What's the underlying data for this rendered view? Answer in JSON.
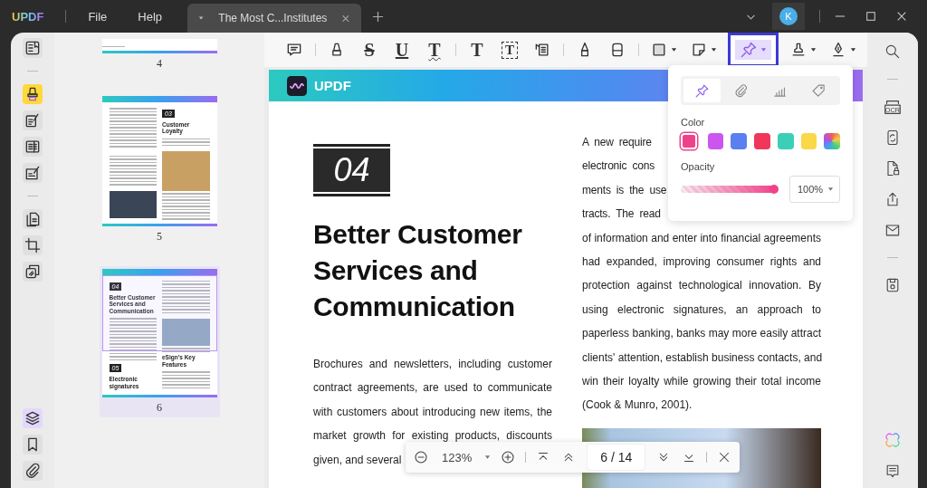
{
  "titlebar": {
    "logo": "UPDF",
    "menu": [
      "File",
      "Help"
    ],
    "tab": {
      "title": "The Most C...Institutes"
    },
    "avatar": "K"
  },
  "left_tool_groups": [
    [
      {
        "kind": "reader",
        "selected": false
      }
    ],
    [
      {
        "kind": "highlight",
        "selected": true
      },
      {
        "kind": "edit",
        "selected": false
      },
      {
        "kind": "form",
        "selected": false
      },
      {
        "kind": "sign",
        "selected": false
      }
    ],
    [
      {
        "kind": "pages",
        "selected": false
      },
      {
        "kind": "crop",
        "selected": false
      },
      {
        "kind": "batch",
        "selected": false
      }
    ]
  ],
  "left_bottom_tools": [
    {
      "kind": "layers",
      "selected": true
    },
    {
      "kind": "bookmark",
      "selected": false
    },
    {
      "kind": "clip",
      "selected": false
    }
  ],
  "thumbnails": [
    {
      "kind": "tail",
      "page": "4",
      "selected": false
    },
    {
      "kind": "loyalty",
      "page": "5",
      "selected": false,
      "number": "03",
      "heading": "Customer Loyalty"
    },
    {
      "kind": "services",
      "page": "6",
      "selected": true,
      "number": "04",
      "heading": "Better Customer Services and Communication",
      "number_2": "05",
      "heading_2": "Electronic signatures",
      "subheading": "eSign's Key Features"
    }
  ],
  "toolbar_groups": [
    [
      {
        "kind": "comment",
        "selected": false
      }
    ],
    [
      {
        "kind": "highlighter",
        "selected": false
      },
      {
        "kind": "glyph-strike",
        "glyph": "S",
        "selected": false
      },
      {
        "kind": "glyph-underline",
        "glyph": "U",
        "selected": false
      },
      {
        "kind": "glyph-squiggly",
        "glyph": "T",
        "selected": false
      }
    ],
    [
      {
        "kind": "glyph-plain",
        "glyph": "T",
        "selected": false
      },
      {
        "kind": "glyph-boxed",
        "glyph": "T",
        "selected": false
      },
      {
        "kind": "callout",
        "selected": false
      }
    ],
    [
      {
        "kind": "pencil",
        "selected": false
      },
      {
        "kind": "eraser",
        "selected": false
      }
    ],
    [
      {
        "kind": "shape",
        "selected": false,
        "dropdown": true
      },
      {
        "kind": "sticker",
        "selected": false,
        "dropdown": true
      },
      {
        "kind": "pin",
        "selected": true,
        "dropdown": true
      },
      {
        "kind": "stamp",
        "selected": false,
        "dropdown": true
      },
      {
        "kind": "signature",
        "selected": false,
        "dropdown": true
      }
    ]
  ],
  "document": {
    "banner_logo": "UPDF",
    "number": "04",
    "heading": [
      "Better Customer",
      "Services and",
      "Communication"
    ],
    "left_lines": [
      "Brochures and newsletters, including customer",
      "contract agreements, are used to communicate",
      "with customers about introducing new items, the",
      "market growth for existing products, discounts",
      "given, and several"
    ],
    "right_lines": [
      "A new require",
      "electronic cons",
      "ments is the use",
      "tracts. The read",
      "of information and enter into financial agreements",
      "had expanded, improving consumer rights and",
      "protection against technological innovation. By",
      "using electronic signatures, an approach to",
      "paperless banking, banks may more easily attract",
      "clients' attention, establish business contacts, and",
      "win their loyalty while growing their total income",
      "(Cook & Munro, 2001)."
    ]
  },
  "popup": {
    "tabs": [
      {
        "kind": "pin",
        "selected": true
      },
      {
        "kind": "clip",
        "selected": false
      },
      {
        "kind": "chart",
        "selected": false
      },
      {
        "kind": "tag",
        "selected": false
      }
    ],
    "color_label": "Color",
    "colors": [
      {
        "kind": "solid",
        "color": "#f0428a",
        "selected": true
      },
      {
        "kind": "solid",
        "color": "#cc55f0",
        "selected": false
      },
      {
        "kind": "solid",
        "color": "#5a7ff0",
        "selected": false
      },
      {
        "kind": "solid",
        "color": "#f0365a",
        "selected": false
      },
      {
        "kind": "solid",
        "color": "#3ccfb8",
        "selected": false
      },
      {
        "kind": "solid",
        "color": "#f9d84a",
        "selected": false
      },
      {
        "kind": "spectrum",
        "selected": false
      }
    ],
    "opacity_label": "Opacity",
    "opacity": {
      "level": 1
    },
    "opacity_value": "100%"
  },
  "nav": {
    "zoom": "123%",
    "page": "6 / 14"
  },
  "right_tool_groups": [
    [
      {
        "kind": "search"
      }
    ],
    [
      {
        "kind": "ocr",
        "label": "OCR"
      },
      {
        "kind": "convert"
      },
      {
        "kind": "protect"
      },
      {
        "kind": "share"
      },
      {
        "kind": "mail"
      }
    ],
    [
      {
        "kind": "save"
      }
    ]
  ],
  "right_bottom_tools": [
    {
      "kind": "ai"
    },
    {
      "kind": "feedback"
    }
  ]
}
